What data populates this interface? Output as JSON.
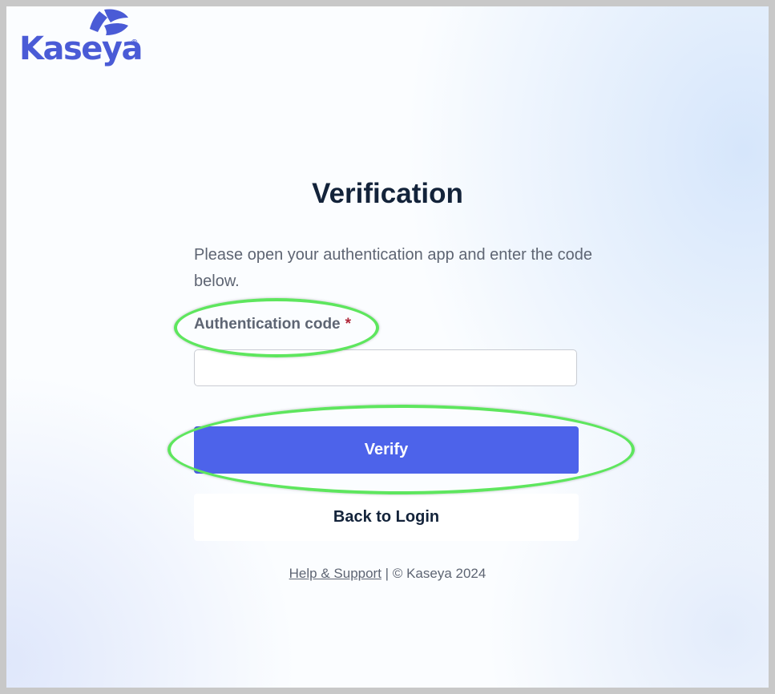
{
  "brand": {
    "logo_text": "Kaseya",
    "registered_mark": "®",
    "logo_color": "#4a5bd6"
  },
  "page": {
    "title": "Verification",
    "instructions": "Please open your authentication app and enter the code below."
  },
  "form": {
    "code_label": "Authentication code",
    "required_marker": "*",
    "code_value": "",
    "verify_label": "Verify",
    "back_label": "Back to Login"
  },
  "footer": {
    "help_link": "Help & Support",
    "separator": " | ",
    "copyright": "© Kaseya 2024"
  },
  "colors": {
    "primary_button": "#4d63ea",
    "title_text": "#13233a",
    "annotation_highlight": "#5ee65e"
  }
}
